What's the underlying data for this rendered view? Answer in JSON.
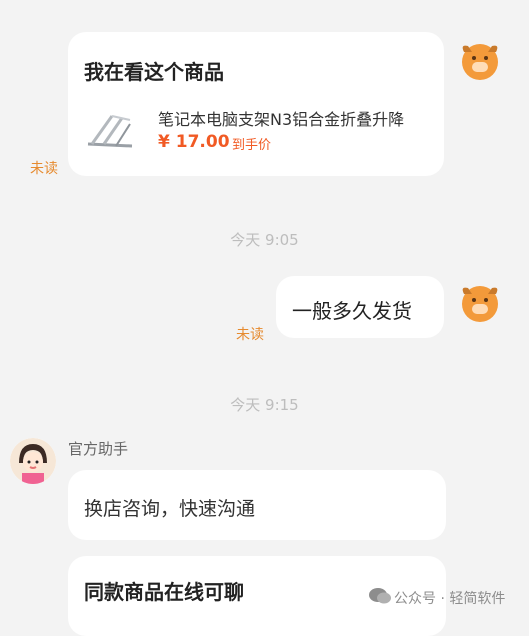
{
  "messages": {
    "product_card": {
      "title": "我在看这个商品",
      "product_name": "笔记本电脑支架N3铝合金折叠升降",
      "price": "¥ 17.00",
      "price_note": "到手价",
      "status": "未读"
    },
    "time_1": "今天 9:05",
    "text_msg": {
      "text": "一般多久发货",
      "status": "未读"
    },
    "time_2": "今天 9:15",
    "assistant": {
      "name": "官方助手",
      "message": "换店咨询，快速沟通",
      "card_title": "同款商品在线可聊"
    }
  },
  "watermark": {
    "text": "公众号 · 轻简软件"
  },
  "colors": {
    "background": "#f3f3f3",
    "unread": "#e68a2e",
    "price": "#f15a24",
    "avatar_orange": "#f39a3a"
  },
  "icons": [
    "ox-avatar-icon",
    "assistant-avatar-icon",
    "laptop-stand-icon",
    "wechat-icon"
  ]
}
